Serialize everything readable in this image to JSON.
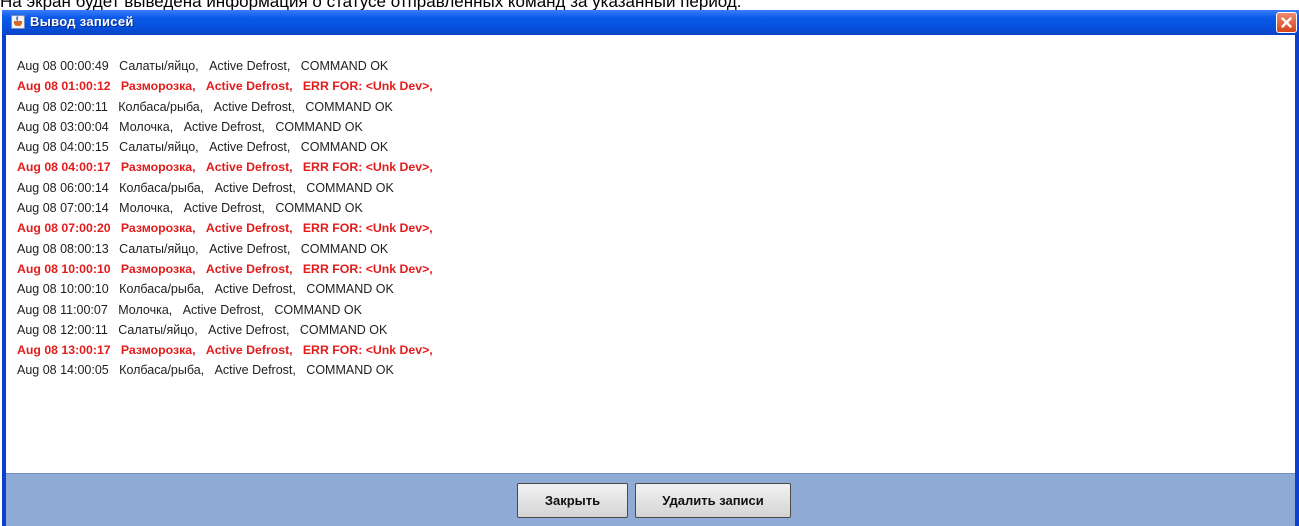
{
  "page": {
    "caption": "На экран будет выведена информация о статусе отправленных команд за указанный период."
  },
  "window": {
    "title": "Вывод записей",
    "title_bar_color": "#0a5ae8",
    "icons": {
      "app": "java-cup-icon",
      "close": "close-icon"
    }
  },
  "colors": {
    "error_text": "#e31b1b",
    "normal_text": "#1e1e1e",
    "bottom_panel": "#8faad5"
  },
  "log": {
    "entries": [
      {
        "time": "Aug 08 00:00:49",
        "device": "Салаты/яйцо,",
        "mode": "Active Defrost,",
        "status": "COMMAND OK",
        "error": false
      },
      {
        "time": "Aug 08 01:00:12",
        "device": "Разморозка,",
        "mode": "Active Defrost,",
        "status": "ERR FOR: <Unk Dev>,",
        "error": true
      },
      {
        "time": "Aug 08 02:00:11",
        "device": "Колбаса/рыба,",
        "mode": "Active Defrost,",
        "status": "COMMAND OK",
        "error": false
      },
      {
        "time": "Aug 08 03:00:04",
        "device": "Молочка,",
        "mode": "Active Defrost,",
        "status": "COMMAND OK",
        "error": false
      },
      {
        "time": "Aug 08 04:00:15",
        "device": "Салаты/яйцо,",
        "mode": "Active Defrost,",
        "status": "COMMAND OK",
        "error": false
      },
      {
        "time": "Aug 08 04:00:17",
        "device": "Разморозка,",
        "mode": "Active Defrost,",
        "status": "ERR FOR: <Unk Dev>,",
        "error": true
      },
      {
        "time": "Aug 08 06:00:14",
        "device": "Колбаса/рыба,",
        "mode": "Active Defrost,",
        "status": "COMMAND OK",
        "error": false
      },
      {
        "time": "Aug 08 07:00:14",
        "device": "Молочка,",
        "mode": "Active Defrost,",
        "status": "COMMAND OK",
        "error": false
      },
      {
        "time": "Aug 08 07:00:20",
        "device": "Разморозка,",
        "mode": "Active Defrost,",
        "status": "ERR FOR: <Unk Dev>,",
        "error": true
      },
      {
        "time": "Aug 08 08:00:13",
        "device": "Салаты/яйцо,",
        "mode": "Active Defrost,",
        "status": "COMMAND OK",
        "error": false
      },
      {
        "time": "Aug 08 10:00:10",
        "device": "Разморозка,",
        "mode": "Active Defrost,",
        "status": "ERR FOR: <Unk Dev>,",
        "error": true
      },
      {
        "time": "Aug 08 10:00:10",
        "device": "Колбаса/рыба,",
        "mode": "Active Defrost,",
        "status": "COMMAND OK",
        "error": false
      },
      {
        "time": "Aug 08 11:00:07",
        "device": "Молочка,",
        "mode": "Active Defrost,",
        "status": "COMMAND OK",
        "error": false
      },
      {
        "time": "Aug 08 12:00:11",
        "device": "Салаты/яйцо,",
        "mode": "Active Defrost,",
        "status": "COMMAND OK",
        "error": false
      },
      {
        "time": "Aug 08 13:00:17",
        "device": "Разморозка,",
        "mode": "Active Defrost,",
        "status": "ERR FOR: <Unk Dev>,",
        "error": true
      },
      {
        "time": "Aug 08 14:00:05",
        "device": "Колбаса/рыба,",
        "mode": "Active Defrost,",
        "status": "COMMAND OK",
        "error": false
      }
    ]
  },
  "buttons": {
    "close_label": "Закрыть",
    "delete_label": "Удалить записи"
  }
}
